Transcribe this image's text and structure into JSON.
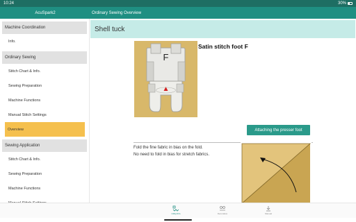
{
  "status_bar": {
    "time": "10:24",
    "battery": "30%"
  },
  "app_bar": {
    "app_title": "AcuSpark2",
    "breadcrumb": "Ordinary Sewing  Overview"
  },
  "sidebar": {
    "sections": [
      {
        "label": "Machine Coordination",
        "items": [
          {
            "label": "Info."
          }
        ]
      },
      {
        "label": "Ordinary Sewing",
        "items": [
          {
            "label": "Stitch Chart & Info."
          },
          {
            "label": "Sewing Preparation"
          },
          {
            "label": "Machine Functions"
          },
          {
            "label": "Manual Stitch Settings"
          },
          {
            "label": "Overview",
            "selected": true
          }
        ]
      },
      {
        "label": "Sewing Application",
        "items": [
          {
            "label": "Stitch Chart & Info."
          },
          {
            "label": "Sewing Preparation"
          },
          {
            "label": "Machine Functions"
          },
          {
            "label": "Manual Stitch Settings"
          }
        ]
      }
    ]
  },
  "main": {
    "title": "Shell tuck",
    "foot_name": "Satin stitch foot F",
    "foot_letter": "F",
    "attach_button": "Attaching the presser foot",
    "instructions": [
      "Fold the fine fabric in bias on the fold.",
      "No need to fold in bias for stretch fabrics."
    ]
  },
  "bottom_nav": [
    {
      "label": "Utility/Info",
      "icon": "utility-icon",
      "active": true
    },
    {
      "label": "Decorative",
      "icon": "decorative-icon",
      "active": false
    },
    {
      "label": "Manual",
      "icon": "manual-icon",
      "active": false
    }
  ],
  "colors": {
    "primary": "#1f8f82",
    "status_bar": "#1e6e63",
    "selected": "#f5c04e",
    "banner": "#c5ebe7",
    "fabric": "#d8b86a"
  }
}
